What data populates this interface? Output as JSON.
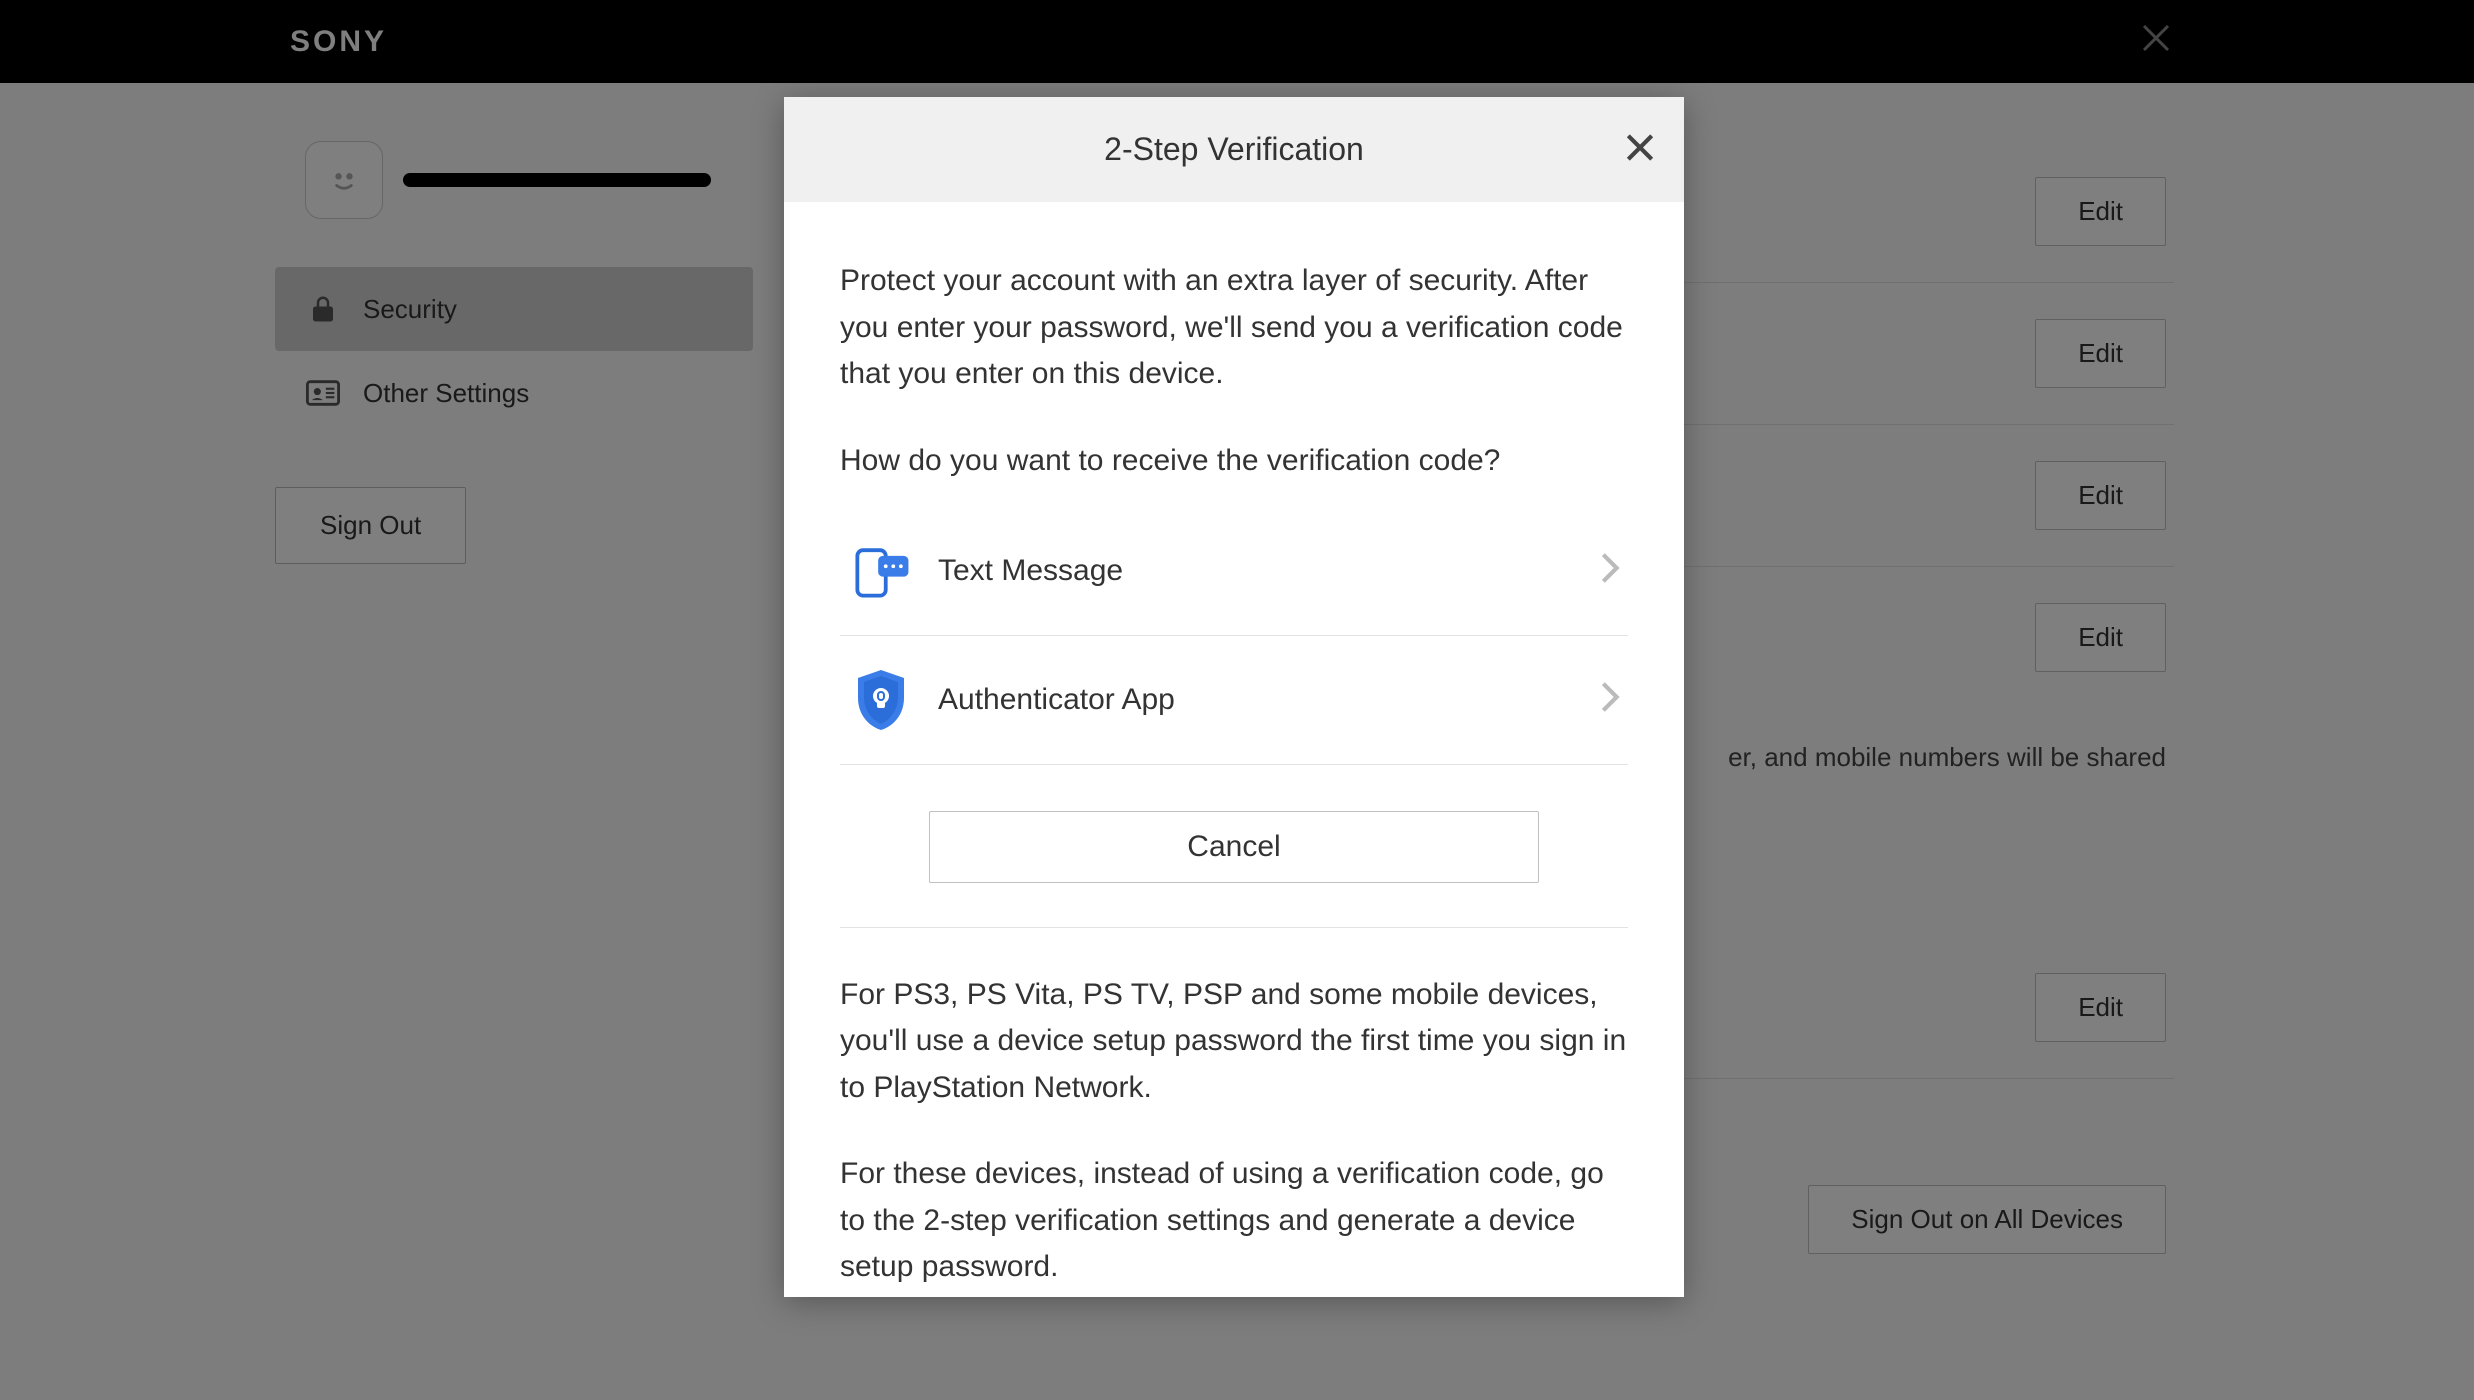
{
  "header": {
    "logo_text": "SONY"
  },
  "sidebar": {
    "nav": [
      {
        "label": "Security",
        "icon": "lock"
      },
      {
        "label": "Other Settings",
        "icon": "id-card"
      }
    ],
    "signout_label": "Sign Out"
  },
  "content": {
    "rows": [
      {
        "edit_label": "Edit"
      },
      {
        "edit_label": "Edit"
      },
      {
        "edit_label": "Edit"
      },
      {
        "edit_label": "Edit"
      }
    ],
    "info_suffix": "er, and mobile numbers will be shared",
    "bottom_row": {
      "edit_label": "Edit"
    },
    "signout_all_label": "Sign Out on All Devices"
  },
  "modal": {
    "title": "2-Step Verification",
    "intro": "Protect your account with an extra layer of security. After you enter your password, we'll send you a verification code that you enter on this device.",
    "question": "How do you want to receive the verification code?",
    "options": [
      {
        "label": "Text Message",
        "icon": "sms"
      },
      {
        "label": "Authenticator App",
        "icon": "shield-lock"
      }
    ],
    "cancel_label": "Cancel",
    "footer_1": "For PS3, PS Vita, PS TV, PSP and some mobile devices, you'll use a device setup password the first time you sign in to PlayStation Network.",
    "footer_2": "For these devices, instead of using a verification code, go to the 2-step verification settings and generate a device setup password."
  }
}
